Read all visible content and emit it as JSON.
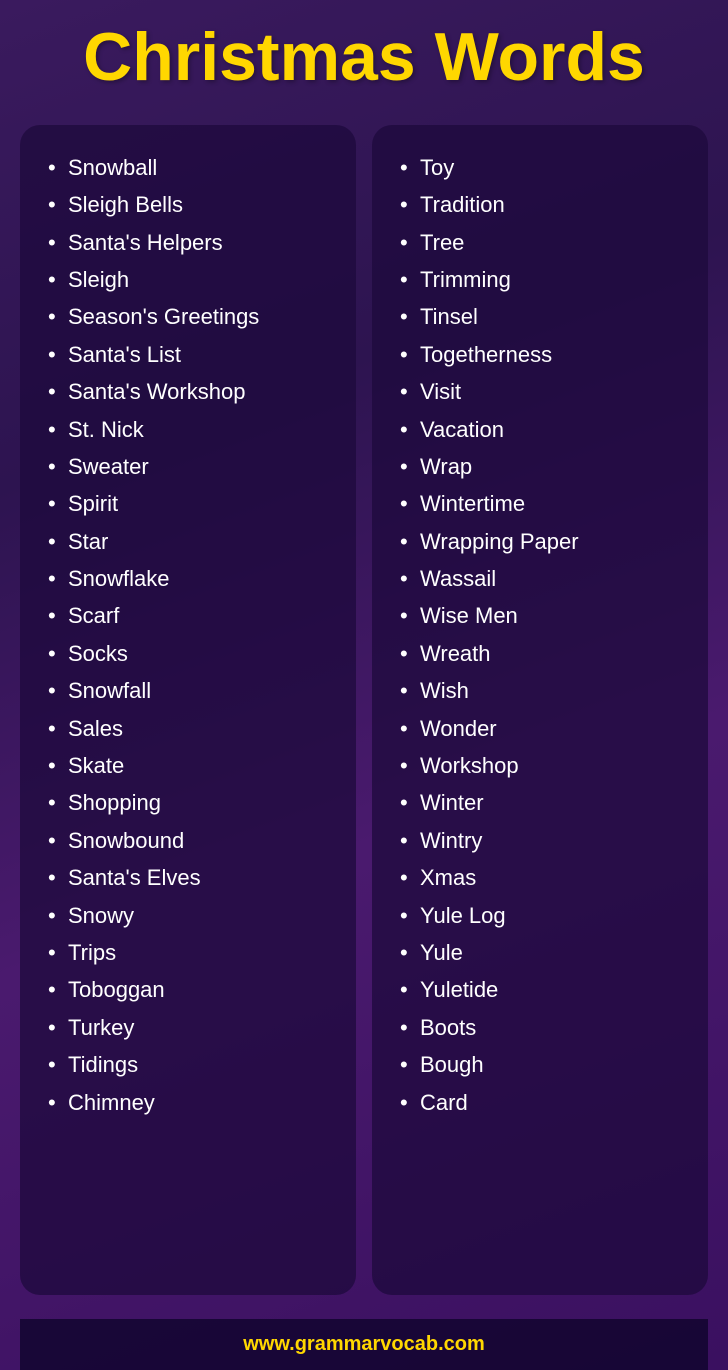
{
  "title": "Christmas Words",
  "left_column": {
    "items": [
      "Snowball",
      "Sleigh Bells",
      "Santa's Helpers",
      "Sleigh",
      "Season's Greetings",
      "Santa's List",
      "Santa's Workshop",
      "St. Nick",
      "Sweater",
      "Spirit",
      "Star",
      "Snowflake",
      "Scarf",
      "Socks",
      "Snowfall",
      "Sales",
      "Skate",
      "Shopping",
      "Snowbound",
      "Santa's Elves",
      "Snowy",
      "Trips",
      "Toboggan",
      "Turkey",
      "Tidings",
      "Chimney"
    ]
  },
  "right_column": {
    "items": [
      "Toy",
      "Tradition",
      "Tree",
      "Trimming",
      "Tinsel",
      "Togetherness",
      "Visit",
      "Vacation",
      "Wrap",
      "Wintertime",
      "Wrapping Paper",
      "Wassail",
      "Wise Men",
      "Wreath",
      "Wish",
      "Wonder",
      "Workshop",
      "Winter",
      "Wintry",
      "Xmas",
      "Yule Log",
      "Yule",
      "Yuletide",
      "Boots",
      "Bough",
      "Card"
    ]
  },
  "footer": {
    "url": "www.grammarvocab.com"
  }
}
